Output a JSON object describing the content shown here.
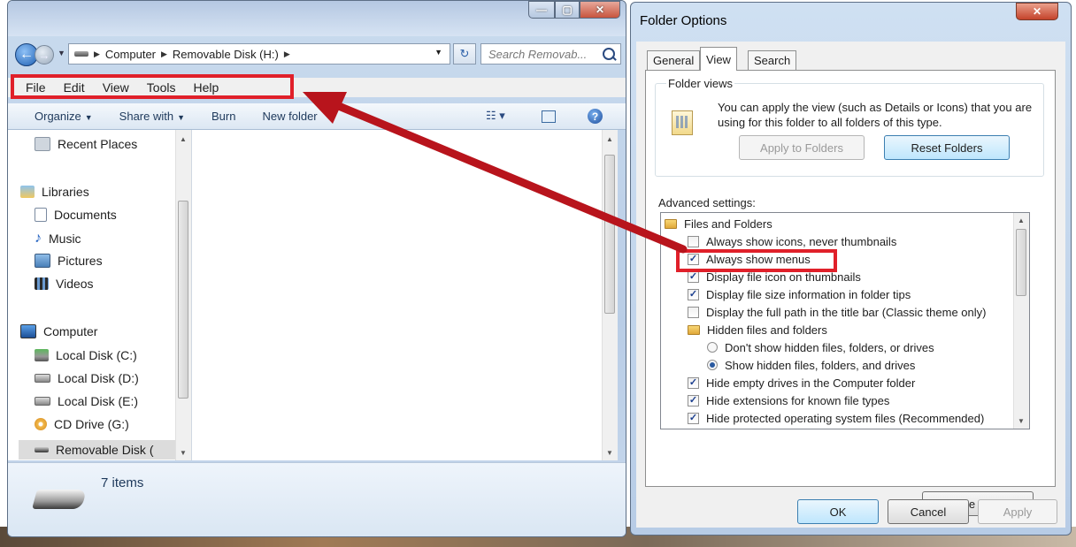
{
  "explorer": {
    "breadcrumb": [
      "Computer",
      "Removable Disk (H:)"
    ],
    "search_placeholder": "Search Removab...",
    "menu": [
      "File",
      "Edit",
      "View",
      "Tools",
      "Help"
    ],
    "commands": {
      "organize": "Organize",
      "share_with": "Share with",
      "burn": "Burn",
      "new_folder": "New folder"
    },
    "nav": {
      "recent_places": "Recent Places",
      "libraries": "Libraries",
      "documents": "Documents",
      "music": "Music",
      "pictures": "Pictures",
      "videos": "Videos",
      "computer": "Computer",
      "local_c": "Local Disk (C:)",
      "local_d": "Local Disk (D:)",
      "local_e": "Local Disk (E:)",
      "cd_drive": "CD Drive (G:)",
      "removable": "Removable Disk ("
    },
    "details": {
      "count": "7 items"
    }
  },
  "dialog": {
    "title": "Folder Options",
    "tabs": [
      "General",
      "View",
      "Search"
    ],
    "folder_views": {
      "label": "Folder views",
      "text": "You can apply the view (such as Details or Icons) that you are using for this folder to all folders of this type.",
      "apply_btn": "Apply to Folders",
      "reset_btn": "Reset Folders"
    },
    "advanced_label": "Advanced settings:",
    "settings": {
      "files_and_folders": "Files and Folders",
      "always_icons": "Always show icons, never thumbnails",
      "always_menus": "Always show menus",
      "file_icon_thumb": "Display file icon on thumbnails",
      "file_size_tips": "Display file size information in folder tips",
      "full_path": "Display the full path in the title bar (Classic theme only)",
      "hidden_files": "Hidden files and folders",
      "dont_show_hidden": "Don't show hidden files, folders, or drives",
      "show_hidden": "Show hidden files, folders, and drives",
      "hide_empty": "Hide empty drives in the Computer folder",
      "hide_ext": "Hide extensions for known file types",
      "hide_protected": "Hide protected operating system files (Recommended)"
    },
    "restore_btn": "Restore Defaults",
    "ok_btn": "OK",
    "cancel_btn": "Cancel",
    "apply_btn": "Apply"
  },
  "colors": {
    "highlight": "#e0202a",
    "arrow": "#b8141c"
  }
}
